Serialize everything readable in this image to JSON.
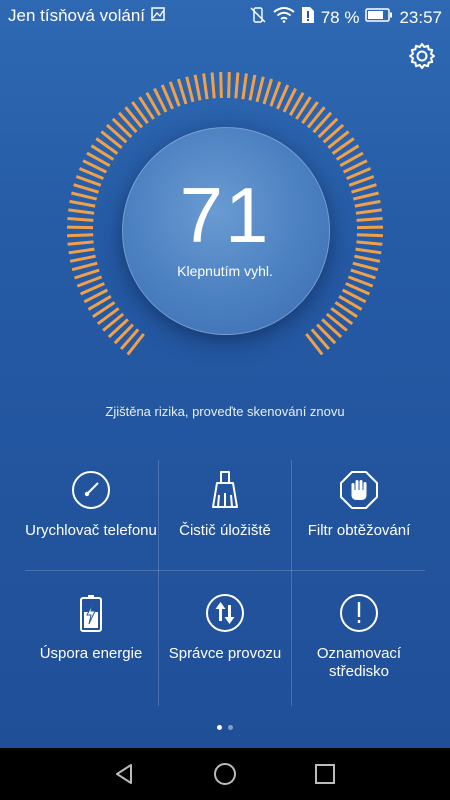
{
  "status_bar": {
    "carrier": "Jen tísňová volání",
    "battery_percent": "78 %",
    "time": "23:57"
  },
  "gauge": {
    "score": "71",
    "hint": "Klepnutím vyhl.",
    "level_fraction": 0.71,
    "accent_color": "#f0a04a"
  },
  "risk_message": "Zjištěna rizika, proveďte skenování znovu",
  "tools": [
    {
      "label": "Urychlovač telefonu",
      "icon": "speedometer-icon"
    },
    {
      "label": "Čistič úložiště",
      "icon": "broom-icon"
    },
    {
      "label": "Filtr obtěžování",
      "icon": "hand-stop-icon"
    },
    {
      "label": "Úspora energie",
      "icon": "battery-icon"
    },
    {
      "label": "Správce provozu",
      "icon": "up-down-arrows-icon"
    },
    {
      "label": "Oznamovací středisko",
      "icon": "exclamation-icon"
    }
  ],
  "pagination": {
    "current": 1,
    "total": 2
  },
  "colors": {
    "background": "#255aa4",
    "accent": "#f0a04a",
    "navbar": "#000000"
  }
}
